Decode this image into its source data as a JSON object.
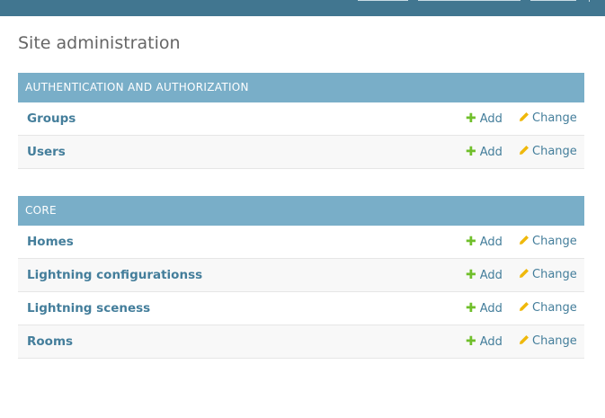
{
  "page_title": "Site administration",
  "colors": {
    "header_bar": "#417690",
    "module_caption_bg": "#79aec8",
    "link": "#447e9b",
    "add_icon": "#70bf2b",
    "change_icon": "#efb80b"
  },
  "modules": [
    {
      "caption": "AUTHENTICATION AND AUTHORIZATION",
      "models": [
        {
          "name": "Groups",
          "add_label": "Add",
          "change_label": "Change"
        },
        {
          "name": "Users",
          "add_label": "Add",
          "change_label": "Change"
        }
      ]
    },
    {
      "caption": "CORE",
      "models": [
        {
          "name": "Homes",
          "add_label": "Add",
          "change_label": "Change"
        },
        {
          "name": "Lightning configurationss",
          "add_label": "Add",
          "change_label": "Change"
        },
        {
          "name": "Lightning sceness",
          "add_label": "Add",
          "change_label": "Change"
        },
        {
          "name": "Rooms",
          "add_label": "Add",
          "change_label": "Change"
        }
      ]
    }
  ],
  "icons": {
    "add": "plus-icon",
    "change": "pencil-icon"
  }
}
